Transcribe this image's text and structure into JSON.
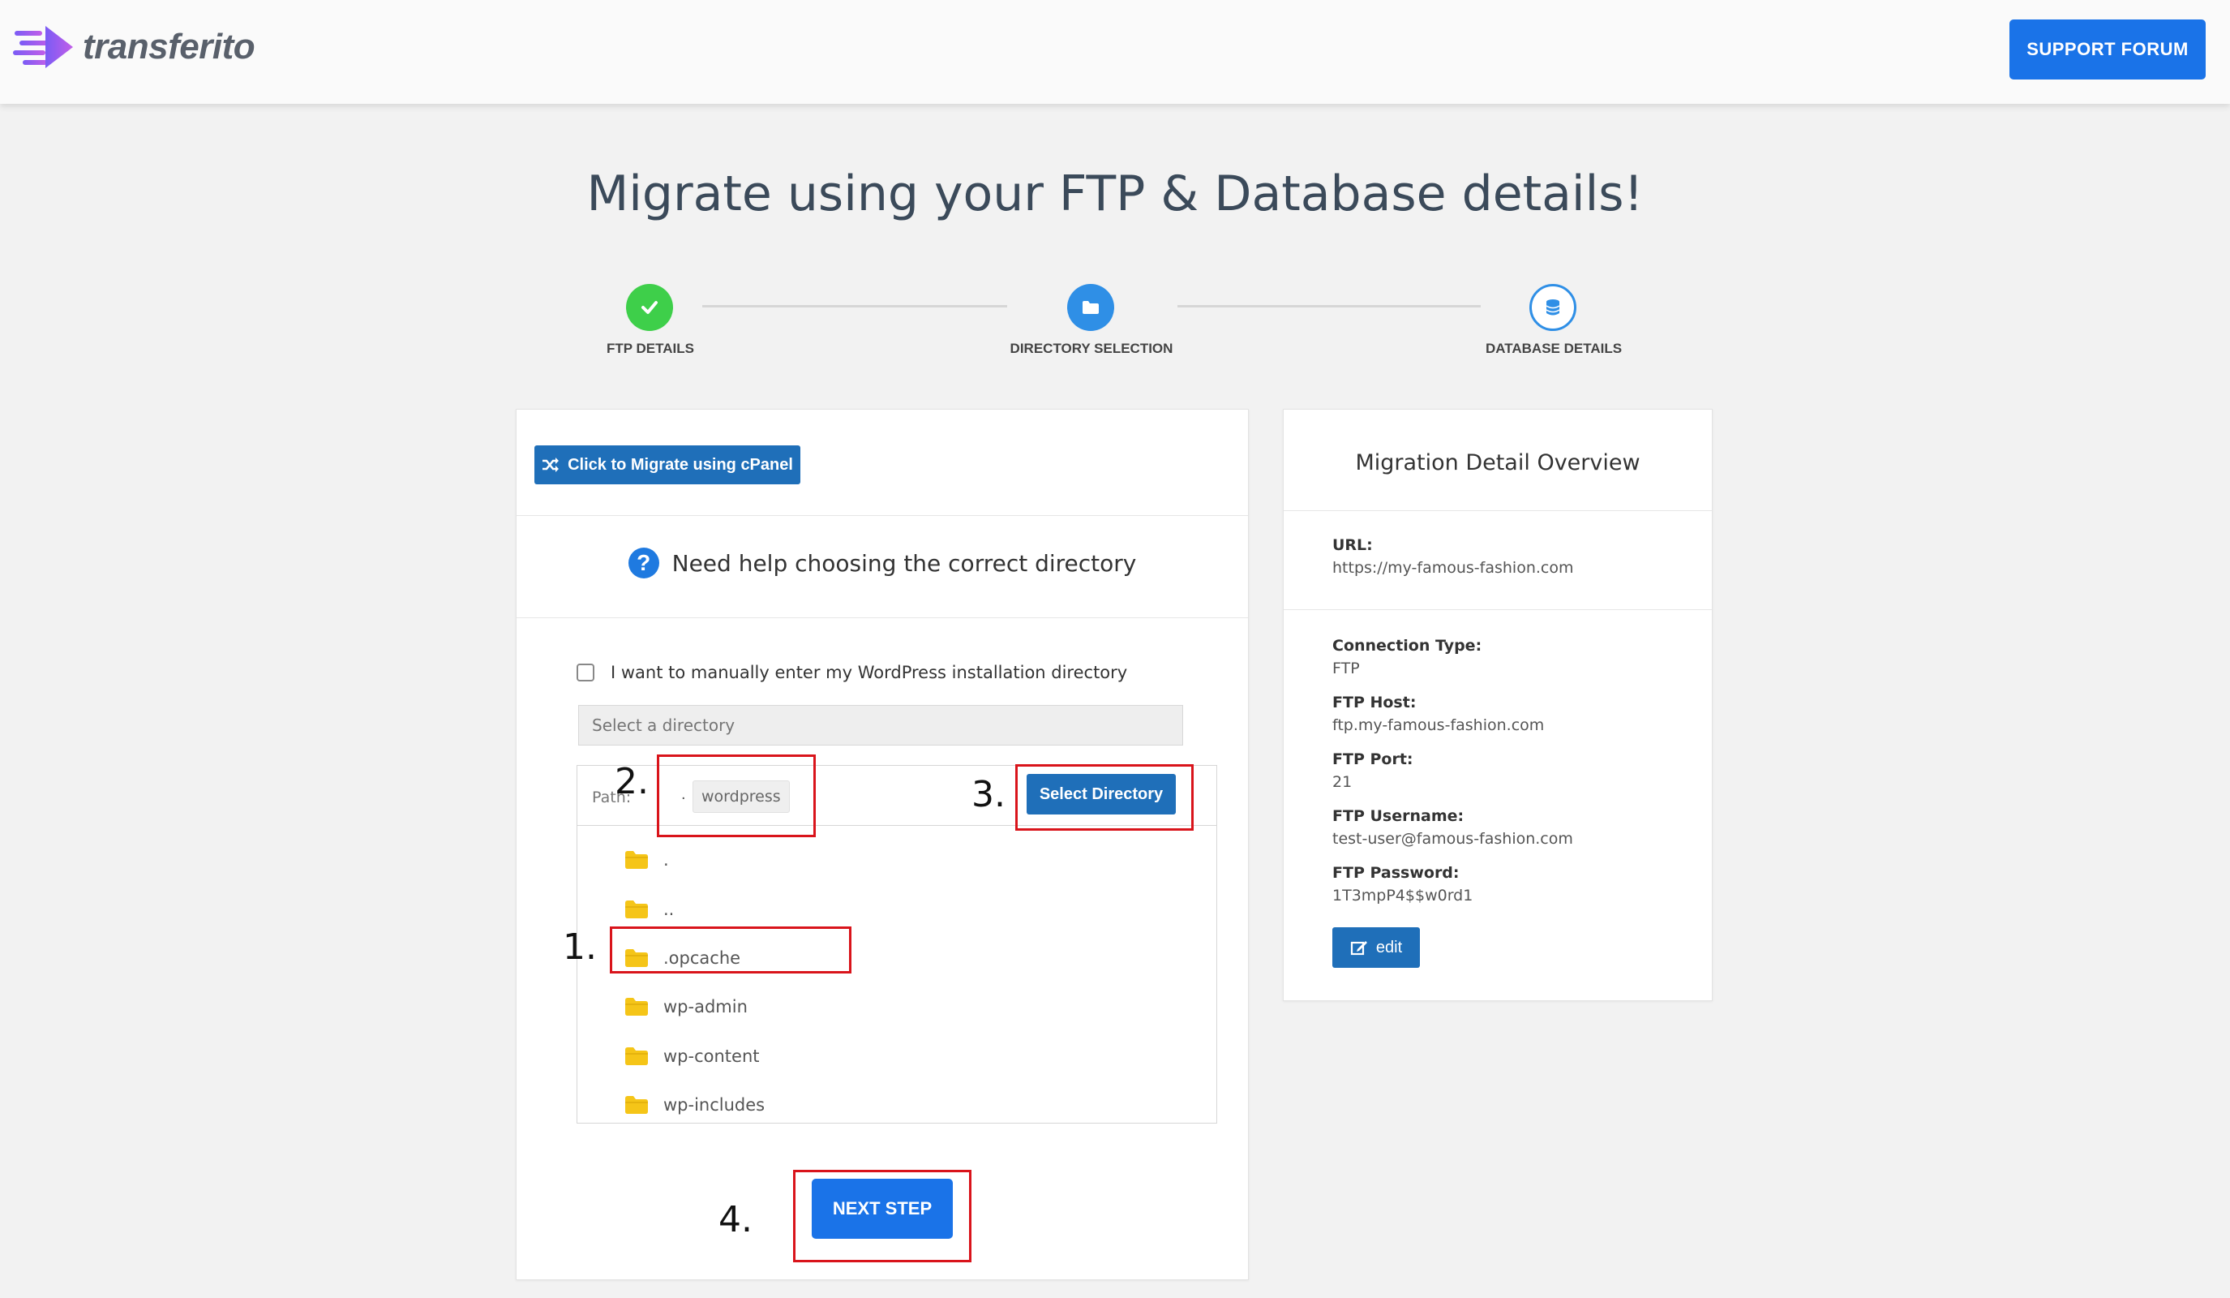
{
  "header": {
    "logo_text": "transferito",
    "support_label": "SUPPORT FORUM"
  },
  "page": {
    "title": "Migrate using your FTP & Database details!"
  },
  "steps": [
    {
      "label": "FTP DETAILS",
      "state": "complete",
      "icon": "check-icon"
    },
    {
      "label": "DIRECTORY SELECTION",
      "state": "active",
      "icon": "folder-icon"
    },
    {
      "label": "DATABASE DETAILS",
      "state": "pending",
      "icon": "database-icon"
    }
  ],
  "main": {
    "cpanel_label": "Click to Migrate using cPanel",
    "help_text": "Need help choosing the correct directory",
    "manual_checkbox_label": "I want to manually enter my WordPress installation directory",
    "manual_checked": false,
    "directory_placeholder": "Select a directory",
    "path_label": "Path:",
    "path_root": ".",
    "path_current": "wordpress",
    "select_directory_label": "Select Directory",
    "folders": [
      ".",
      "..",
      ".opcache",
      "wp-admin",
      "wp-content",
      "wp-includes"
    ],
    "next_label": "NEXT STEP"
  },
  "annotations": [
    "1.",
    "2.",
    "3.",
    "4."
  ],
  "overview": {
    "title": "Migration Detail Overview",
    "url_label": "URL:",
    "url_value": "https://my-famous-fashion.com",
    "connection_type_label": "Connection Type:",
    "connection_type_value": "FTP",
    "ftp_host_label": "FTP Host:",
    "ftp_host_value": "ftp.my-famous-fashion.com",
    "ftp_port_label": "FTP Port:",
    "ftp_port_value": "21",
    "ftp_username_label": "FTP Username:",
    "ftp_username_value": "test-user@famous-fashion.com",
    "ftp_password_label": "FTP Password:",
    "ftp_password_value": "1T3mpP4$$w0rd1",
    "edit_label": "edit"
  },
  "colors": {
    "primary": "#1a73e8",
    "button_dark": "#1f6fb9",
    "success": "#3ecf4a",
    "annotation_red": "#d9141b",
    "folder": "#f5c518"
  }
}
